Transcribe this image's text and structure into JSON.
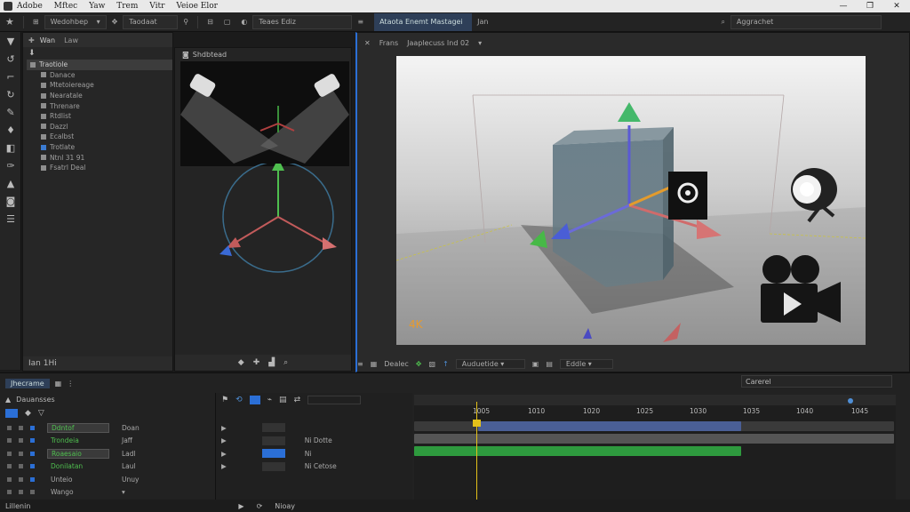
{
  "titlebar": {
    "menu": [
      "Adobe",
      "Mftec",
      "Yaw",
      "Trem",
      "Vitr",
      "Veioe Elor"
    ],
    "minimize": "—",
    "restore": "❐",
    "close": "✕"
  },
  "toolbar": {
    "workspace": "Wedohbep",
    "dropdown2": "Taodaat",
    "field3": "Teaes Ediz",
    "panel_title": "Ataota Enemt Mastagei",
    "panel_alt": "Jan",
    "search_right": "Aggrachet"
  },
  "outliner": {
    "tab1": "Wan",
    "tab2": "Law",
    "rows": [
      "Traotiole",
      "Danace",
      "Mtetoiereage",
      "Nearatale",
      "Threnare",
      "Rtdlist",
      "Dazzl",
      "Ecalbst",
      "Trotlate",
      "Ntnl 31 91",
      "Fsatrl Deal"
    ],
    "footer": "Ian 1Hi"
  },
  "preview": {
    "title": "Shdbtead"
  },
  "viewport": {
    "tab": "Frans",
    "tab2": "Jaaplecuss Ind 02",
    "footer_label1": "Dealec",
    "footer_label2": "Auduetide",
    "footer_label3": "Eddle",
    "gizmo_label": "4K"
  },
  "timeline": {
    "tab": "Jhecrame",
    "layer_panel_title": "Dauansses",
    "right_dropdown": "Carerel",
    "ticks": [
      "1005",
      "1010",
      "1020",
      "1025",
      "1030",
      "1035",
      "1040",
      "1045"
    ],
    "layers": [
      {
        "name": "Ddntof",
        "prop": "Doan"
      },
      {
        "name": "Trondeia",
        "prop": "Jaff"
      },
      {
        "name": "Roaesaio",
        "prop": "Ladl"
      },
      {
        "name": "Donilatan",
        "prop": "Laul"
      },
      {
        "name": "Unteio",
        "prop": "Unuy"
      },
      {
        "name": "Wango",
        "prop": ""
      }
    ],
    "mid_rows": [
      "",
      "Ni Dotte",
      "Ni",
      "Ni Cetose"
    ],
    "footer_left": "Lillenin",
    "footer_mid": "Nioay"
  },
  "colors": {
    "accent_blue": "#2b6fd6",
    "track_green": "#2e9a3e",
    "playhead": "#e4c11a"
  }
}
